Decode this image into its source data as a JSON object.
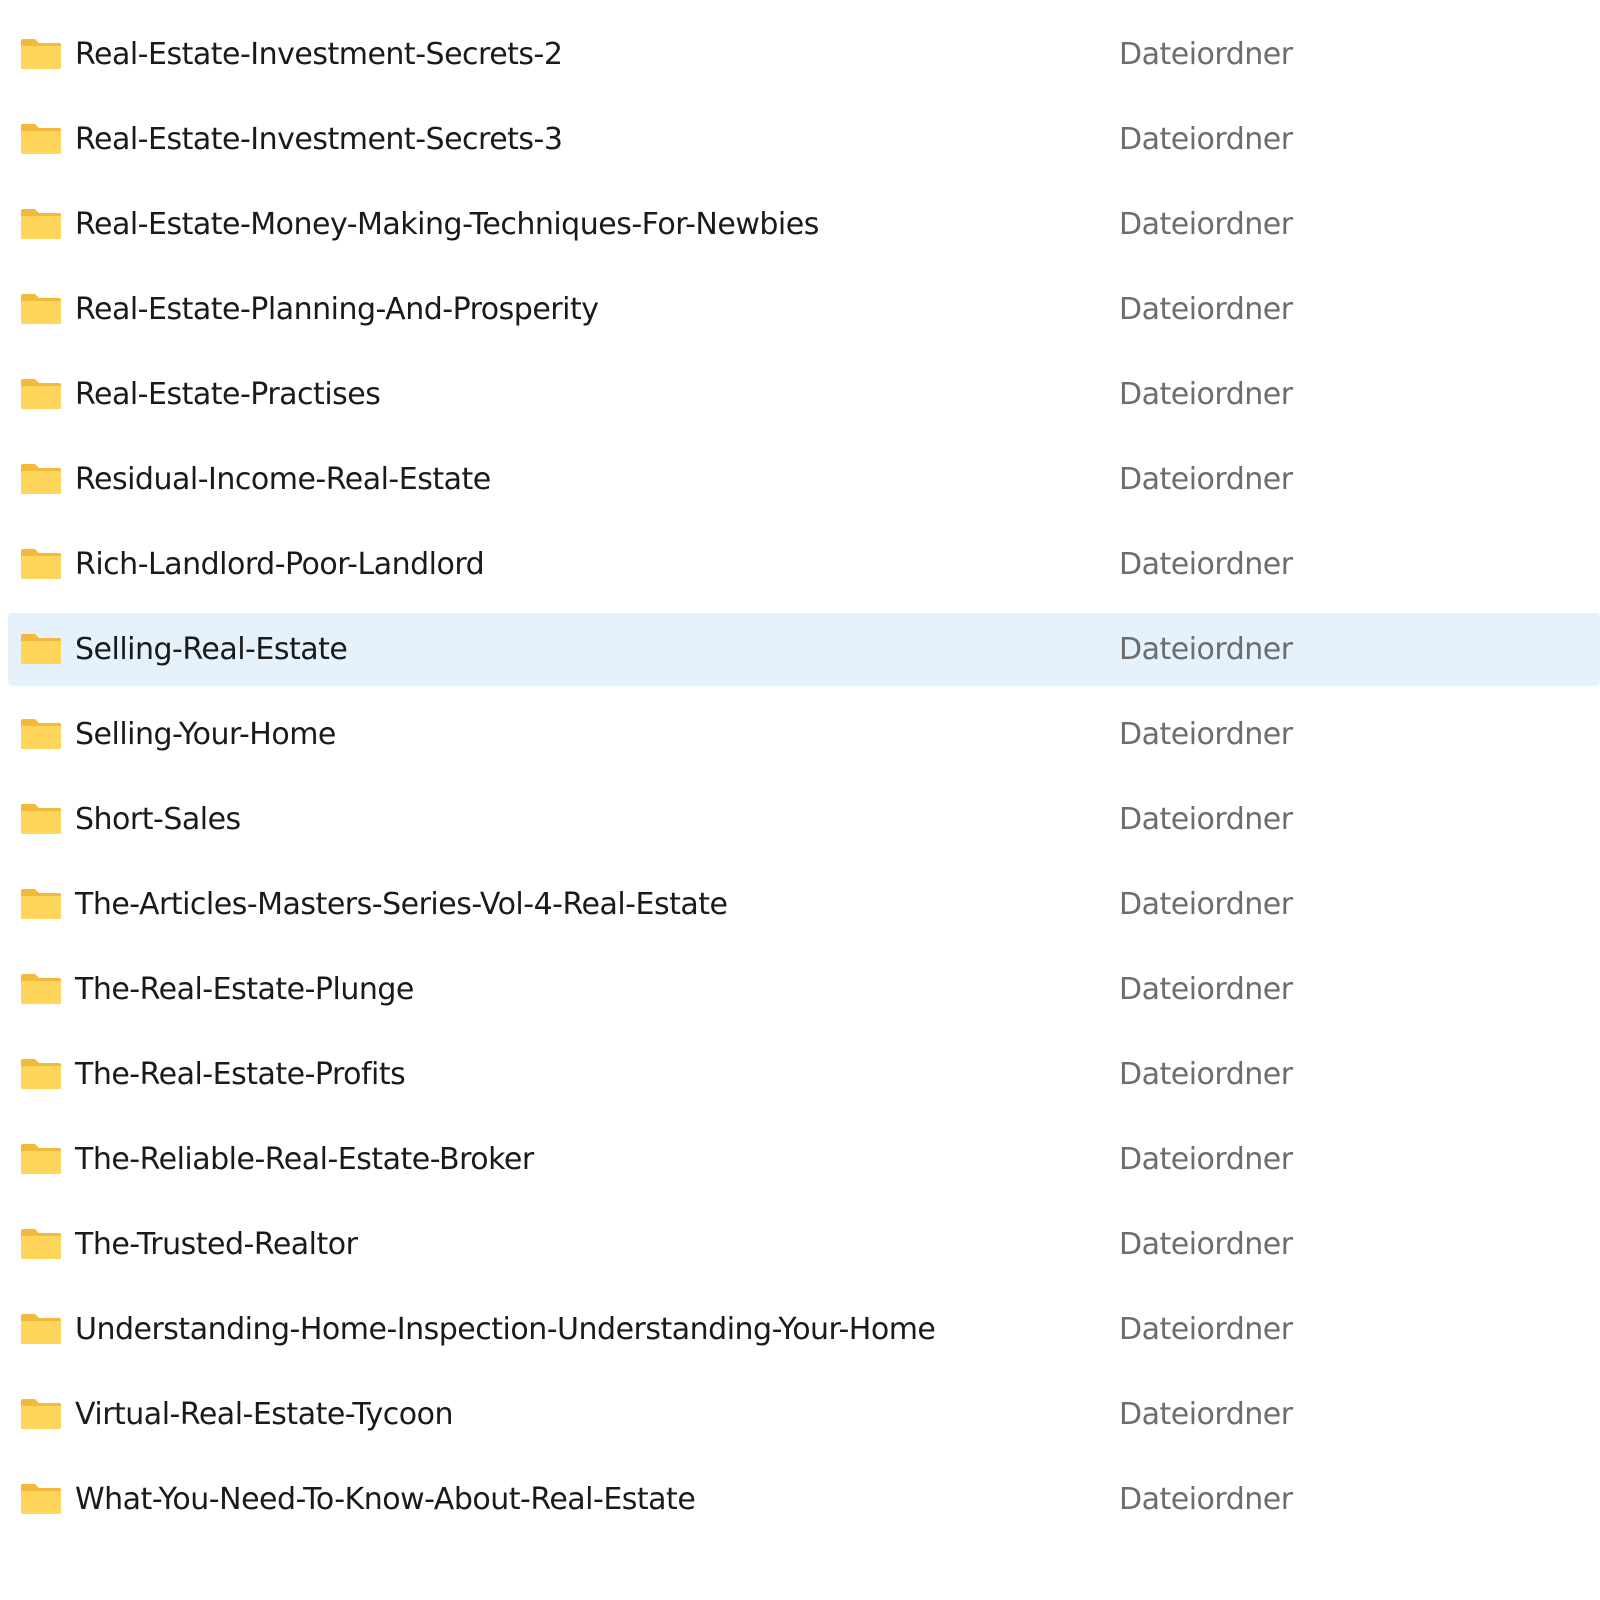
{
  "folders": [
    {
      "name": "Real-Estate-Investment-Secrets-2",
      "type": "Dateiordner",
      "icon": "folder-icon"
    },
    {
      "name": "Real-Estate-Investment-Secrets-3",
      "type": "Dateiordner",
      "icon": "folder-icon"
    },
    {
      "name": "Real-Estate-Money-Making-Techniques-For-Newbies",
      "type": "Dateiordner",
      "icon": "folder-icon"
    },
    {
      "name": "Real-Estate-Planning-And-Prosperity",
      "type": "Dateiordner",
      "icon": "folder-icon"
    },
    {
      "name": "Real-Estate-Practises",
      "type": "Dateiordner",
      "icon": "folder-icon"
    },
    {
      "name": "Residual-Income-Real-Estate",
      "type": "Dateiordner",
      "icon": "folder-icon"
    },
    {
      "name": "Rich-Landlord-Poor-Landlord",
      "type": "Dateiordner",
      "icon": "folder-icon"
    },
    {
      "name": "Selling-Real-Estate",
      "type": "Dateiordner",
      "icon": "folder-icon",
      "selected": true
    },
    {
      "name": "Selling-Your-Home",
      "type": "Dateiordner",
      "icon": "folder-icon"
    },
    {
      "name": "Short-Sales",
      "type": "Dateiordner",
      "icon": "folder-icon"
    },
    {
      "name": "The-Articles-Masters-Series-Vol-4-Real-Estate",
      "type": "Dateiordner",
      "icon": "folder-icon"
    },
    {
      "name": "The-Real-Estate-Plunge",
      "type": "Dateiordner",
      "icon": "folder-icon"
    },
    {
      "name": "The-Real-Estate-Profits",
      "type": "Dateiordner",
      "icon": "folder-icon"
    },
    {
      "name": "The-Reliable-Real-Estate-Broker",
      "type": "Dateiordner",
      "icon": "folder-icon"
    },
    {
      "name": "The-Trusted-Realtor",
      "type": "Dateiordner",
      "icon": "folder-icon"
    },
    {
      "name": "Understanding-Home-Inspection-Understanding-Your-Home",
      "type": "Dateiordner",
      "icon": "folder-icon"
    },
    {
      "name": "Virtual-Real-Estate-Tycoon",
      "type": "Dateiordner",
      "icon": "folder-icon"
    },
    {
      "name": "What-You-Need-To-Know-About-Real-Estate",
      "type": "Dateiordner",
      "icon": "folder-icon"
    }
  ],
  "colors": {
    "selection_background": "#e5f1fb",
    "folder_body": "#ffd55c",
    "folder_back": "#f2b93b",
    "name_text": "#1a1a1a",
    "type_text": "#6d6d6d"
  }
}
